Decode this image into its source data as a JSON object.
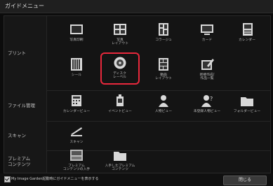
{
  "window": {
    "title": "ガイドメニュー"
  },
  "categories": {
    "print": "プリント",
    "file": "ファイル管理",
    "scan": "スキャン",
    "premium": "プレミアム\nコンテンツ"
  },
  "print_items": [
    {
      "label": "写真印刷",
      "icon": "photo-print-icon"
    },
    {
      "label": "写真\nレイアウト",
      "icon": "photo-layout-icon"
    },
    {
      "label": "コラージュ",
      "icon": "collage-icon"
    },
    {
      "label": "カード",
      "icon": "card-icon"
    },
    {
      "label": "カレンダー",
      "icon": "calendar-icon"
    },
    {
      "label": "シール",
      "icon": "sticker-icon"
    },
    {
      "label": "ディスク\nレーベル",
      "icon": "disc-label-icon",
      "selected": true
    },
    {
      "label": "動画\nレイアウト",
      "icon": "video-layout-icon"
    },
    {
      "label": "新規作成/\n作品一覧",
      "icon": "new-item-icon"
    }
  ],
  "file_items": [
    {
      "label": "カレンダービュー",
      "icon": "calendar-view-icon"
    },
    {
      "label": "イベントビュー",
      "icon": "event-view-icon"
    },
    {
      "label": "人物ビュー",
      "icon": "people-view-icon"
    },
    {
      "label": "未登録人物ビュー",
      "icon": "unregistered-people-icon"
    },
    {
      "label": "フォルダービュー",
      "icon": "folder-view-icon"
    }
  ],
  "scan_items": [
    {
      "label": "スキャン",
      "icon": "scan-icon"
    }
  ],
  "premium_items": [
    {
      "label": "プレミアム\nコンテンツの入手",
      "icon": "premium-get-icon"
    },
    {
      "label": "入手したプレミアム\nコンテンツ",
      "icon": "premium-folder-icon"
    }
  ],
  "footer": {
    "checkbox_label": "My Image Garden起動時にガイドメニューを表示する",
    "checkbox_checked": true,
    "close_label": "閉じる"
  },
  "colors": {
    "accent": "#e8283c",
    "background": "#0c0c0c"
  }
}
